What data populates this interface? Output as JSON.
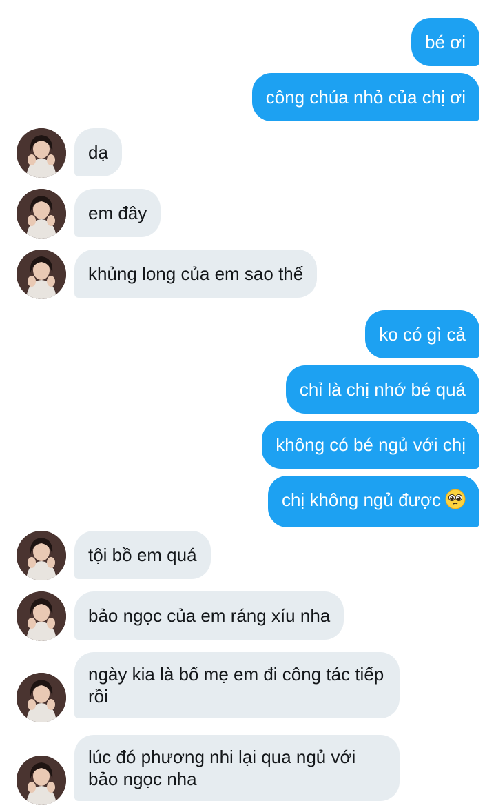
{
  "conversation": {
    "messages": [
      {
        "side": "out",
        "text": "bé ơi"
      },
      {
        "side": "out",
        "text": "công chúa nhỏ của chị ơi"
      },
      {
        "side": "in",
        "text": "dạ"
      },
      {
        "side": "in",
        "text": "em đây"
      },
      {
        "side": "in",
        "text": "khủng long của em sao thế"
      },
      {
        "side": "out",
        "text": "ko có gì cả"
      },
      {
        "side": "out",
        "text": "chỉ là chị nhớ bé quá"
      },
      {
        "side": "out",
        "text": "không có bé ngủ với chị"
      },
      {
        "side": "out",
        "text": "chị không ngủ được",
        "emoji": "pleading-face"
      },
      {
        "side": "in",
        "text": "tội bồ em quá"
      },
      {
        "side": "in",
        "text": "bảo ngọc của em ráng xíu nha"
      },
      {
        "side": "in",
        "text": "ngày kia là bố mẹ em đi công tác tiếp rồi"
      },
      {
        "side": "in",
        "text": "lúc đó phương nhi lại qua ngủ với bảo ngọc nha"
      }
    ]
  },
  "colors": {
    "outgoing_bubble": "#1da1f2",
    "incoming_bubble": "#e6ecf0",
    "outgoing_text": "#ffffff",
    "incoming_text": "#14171a"
  }
}
